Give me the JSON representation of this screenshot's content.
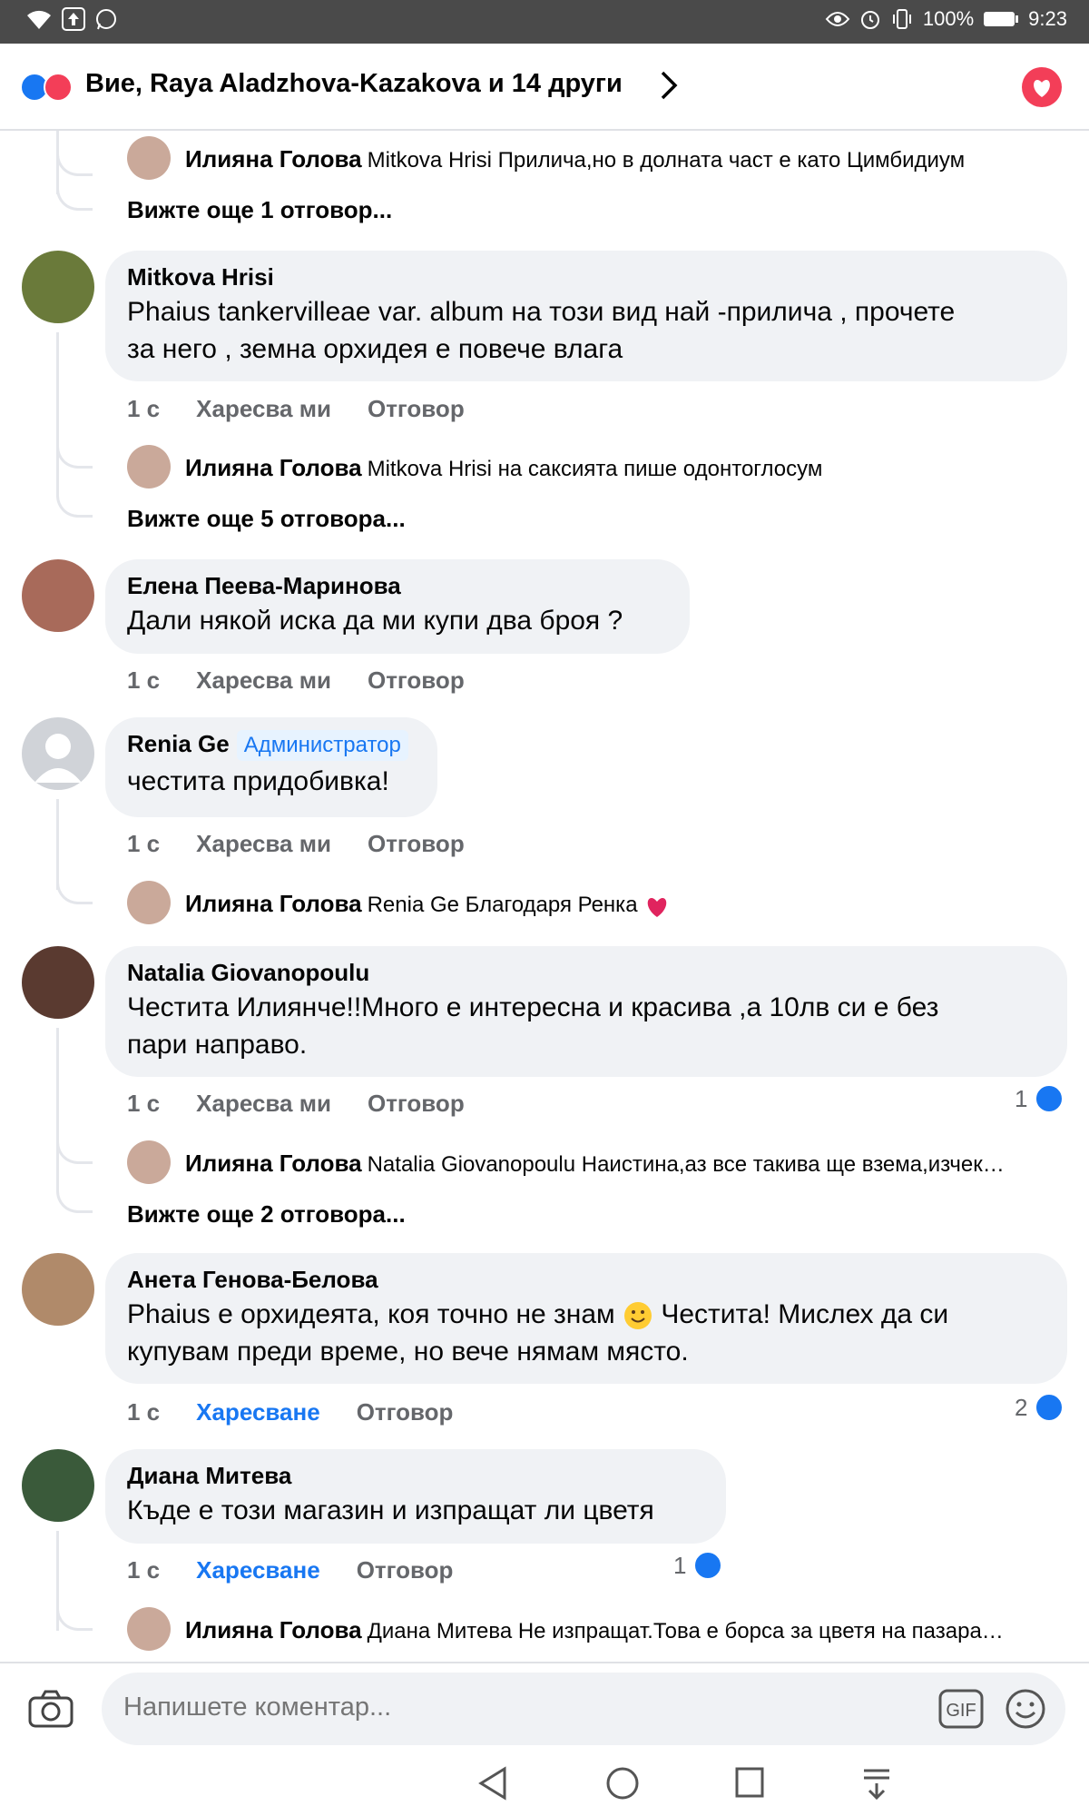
{
  "status_bar": {
    "battery": "100%",
    "time": "9:23"
  },
  "header": {
    "reactions_text": "Вие, Raya Aladzhova-Kazakova и 14 други"
  },
  "comments": [
    {
      "reply": {
        "author": "Илияна Голова",
        "text": "Mitkova Hrisi Прилича,но в долната част е като Цимбидиум"
      },
      "more": "Вижте още 1 отговор..."
    },
    {
      "author": "Mitkova Hrisi",
      "lines": [
        "Phaius tankervilleae var. album  на този вид най -прилича  , прочете",
        "за него , земна орхидея е повече влага"
      ],
      "time": "1 с",
      "like": "Харесва ми",
      "reply_label": "Отговор",
      "reply": {
        "author": "Илияна Голова",
        "text": "Mitkova Hrisi на саксията пише одонтоглосум"
      },
      "more": "Вижте още 5 отговора..."
    },
    {
      "author": "Елена Пеева-Маринова",
      "lines": [
        "Дали някой иска да ми купи два броя ?"
      ],
      "time": "1 с",
      "like": "Харесва ми",
      "reply_label": "Отговор"
    },
    {
      "author": "Renia Ge",
      "badge": "Администратор",
      "lines": [
        "честита придобивка!"
      ],
      "time": "1 с",
      "like": "Харесва ми",
      "reply_label": "Отговор",
      "reply": {
        "author": "Илияна Голова",
        "text": "Renia Ge Благодаря Ренка"
      }
    },
    {
      "author": "Natalia Giovanopoulu",
      "lines": [
        "Честита Илиянче!!Много е интересна и красива ,а 10лв си е без",
        "пари направо."
      ],
      "time": "1 с",
      "like": "Харесва ми",
      "reply_label": "Отговор",
      "reactions": "1",
      "reply": {
        "author": "Илияна Голова",
        "text": "Natalia Giovanopoulu Наистина,аз все такива ще взема,изчек…"
      },
      "more": "Вижте още 2 отговора..."
    },
    {
      "author": "Анета Генова-Белова",
      "lines": [
        "Phaius  е орхидеята, коя точно не знам",
        "Честита! Мислех да си",
        "купувам преди време, но вече нямам място."
      ],
      "time": "1 с",
      "like": "Харесване",
      "reply_label": "Отговор",
      "reactions": "2"
    },
    {
      "author": "Диана Митева",
      "lines": [
        "Къде е този магазин и изпращат ли цветя"
      ],
      "time": "1 с",
      "like": "Харесване",
      "reply_label": "Отговор",
      "reactions": "1",
      "reply": {
        "author": "Илияна Голова",
        "text": "Диана Митева Не изпращат.Това е борса за цветя на пазара…"
      }
    }
  ],
  "composer": {
    "placeholder": "Напишете коментар...",
    "gif": "GIF"
  },
  "colors": {
    "accent": "#1877f2",
    "love": "#f33e58",
    "bubble": "#f0f2f5"
  }
}
